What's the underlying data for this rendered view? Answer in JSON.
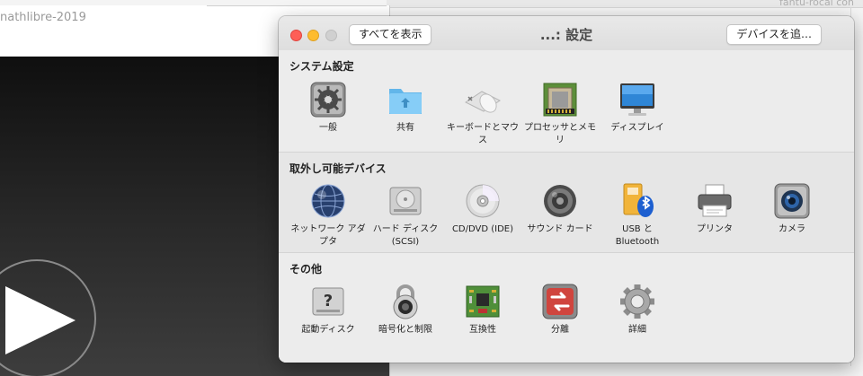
{
  "background": {
    "left_window_title": "nathlibre-2019",
    "right_window_text": "fantu-rocal   con"
  },
  "window": {
    "title": "...: 設定",
    "show_all_button": "すべてを表示",
    "add_device_button": "デバイスを追…"
  },
  "sections": [
    {
      "title": "システム設定",
      "items": [
        {
          "label": "一般",
          "icon": "gear-switch-icon"
        },
        {
          "label": "共有",
          "icon": "shared-folder-icon"
        },
        {
          "label": "キーボードとマウス",
          "icon": "keyboard-mouse-icon"
        },
        {
          "label": "プロセッサとメモリ",
          "icon": "processor-memory-icon"
        },
        {
          "label": "ディスプレイ",
          "icon": "display-icon"
        }
      ]
    },
    {
      "title": "取外し可能デバイス",
      "items": [
        {
          "label": "ネットワーク アダプタ",
          "icon": "network-globe-icon"
        },
        {
          "label": "ハード ディスク (SCSI)",
          "icon": "hard-disk-icon"
        },
        {
          "label": "CD/DVD (IDE)",
          "icon": "cd-dvd-icon"
        },
        {
          "label": "サウンド カード",
          "icon": "speaker-icon"
        },
        {
          "label": "USB と Bluetooth",
          "icon": "usb-bluetooth-icon"
        },
        {
          "label": "プリンタ",
          "icon": "printer-icon"
        },
        {
          "label": "カメラ",
          "icon": "camera-icon"
        }
      ]
    },
    {
      "title": "その他",
      "items": [
        {
          "label": "起動ディスク",
          "icon": "startup-disk-icon"
        },
        {
          "label": "暗号化と制限",
          "icon": "padlock-icon"
        },
        {
          "label": "互換性",
          "icon": "circuit-board-icon"
        },
        {
          "label": "分離",
          "icon": "isolation-icon"
        },
        {
          "label": "詳細",
          "icon": "advanced-gear-icon"
        }
      ]
    }
  ]
}
